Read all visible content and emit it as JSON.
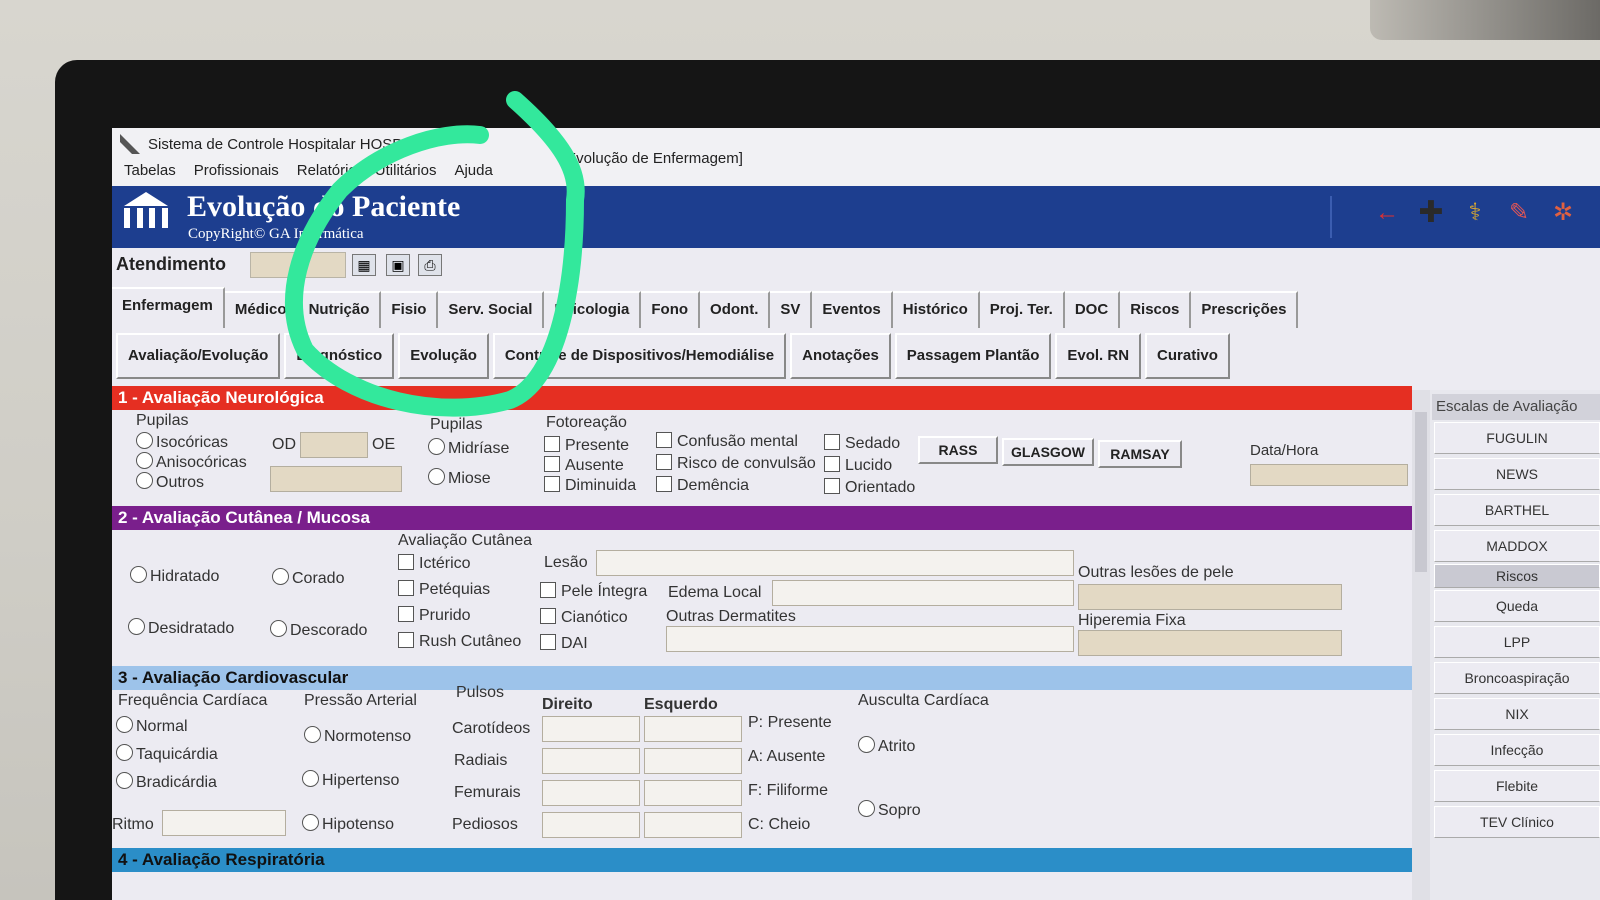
{
  "window": {
    "title": "Sistema de Controle Hospitalar HOSP",
    "subtitle": "[Evolução de Enfermagem]"
  },
  "menu": [
    "Tabelas",
    "Profissionais",
    "Relatório",
    "Utilitários",
    "Ajuda"
  ],
  "banner": {
    "title": "Evolução do Paciente",
    "copyright": "CopyRight© GA Informática"
  },
  "atendimento": {
    "label": "Atendimento",
    "value": ""
  },
  "main_tabs": [
    "Enfermagem",
    "Médico",
    "Nutrição",
    "Fisio",
    "Serv. Social",
    "Psicologia",
    "Fono",
    "Odont.",
    "SV",
    "Eventos",
    "Histórico",
    "Proj. Ter.",
    "DOC",
    "Riscos",
    "Prescrições"
  ],
  "sub_tabs": [
    "Avaliação/Evolução",
    "Diagnóstico",
    "Evolução",
    "Controle de Dispositivos/Hemodiálise",
    "Anotações",
    "Passagem Plantão",
    "Evol. RN",
    "Curativo"
  ],
  "sec1": {
    "title": "1 - Avaliação Neurológica",
    "pupilas_label": "Pupilas",
    "pupilas_opts": [
      "Isocóricas",
      "Anisocóricas",
      "Outros"
    ],
    "od": "OD",
    "oe": "OE",
    "pupilas2_label": "Pupilas",
    "pupilas2_opts": [
      "Midríase",
      "Miose"
    ],
    "foto_label": "Fotoreação",
    "foto_opts": [
      "Presente",
      "Ausente",
      "Diminuida"
    ],
    "mental_opts": [
      "Confusão mental",
      "Risco de convulsão",
      "Demência"
    ],
    "estado_opts": [
      "Sedado",
      "Lucido",
      "Orientado"
    ],
    "buttons": [
      "RASS",
      "GLASGOW",
      "RAMSAY"
    ],
    "datahora": "Data/Hora"
  },
  "sec2": {
    "title": "2 - Avaliação Cutânea / Mucosa",
    "hid_opts": [
      "Hidratado",
      "Desidratado"
    ],
    "cor_opts": [
      "Corado",
      "Descorado"
    ],
    "cutanea_label": "Avaliação Cutânea",
    "cut_opts1": [
      "Ictérico",
      "Petéquias",
      "Prurido",
      "Rush Cutâneo"
    ],
    "lesao": "Lesão",
    "cut_opts2": [
      "Pele Íntegra",
      "Cianótico",
      "DAI"
    ],
    "edema": "Edema Local",
    "outras_derm": "Outras Dermatites",
    "outras_lesoes": "Outras lesões de pele",
    "hiperemia": "Hiperemia Fixa"
  },
  "sec3": {
    "title": "3 - Avaliação Cardiovascular",
    "fc_label": "Frequência Cardíaca",
    "fc_opts": [
      "Normal",
      "Taquicárdia",
      "Bradicárdia"
    ],
    "pa_label": "Pressão Arterial",
    "pa_opts": [
      "Normotenso",
      "Hipertenso",
      "Hipotenso"
    ],
    "pulsos_label": "Pulsos",
    "direito": "Direito",
    "esquerdo": "Esquerdo",
    "pulsos": [
      "Carotídeos",
      "Radiais",
      "Femurais",
      "Pediosos"
    ],
    "legend": [
      "P: Presente",
      "A: Ausente",
      "F: Filiforme",
      "C: Cheio"
    ],
    "ausculta_label": "Ausculta Cardíaca",
    "ausculta_opts": [
      "Atrito",
      "Sopro"
    ],
    "ritmo": "Ritmo"
  },
  "sec4": {
    "title": "4 - Avaliação Respiratória"
  },
  "right_panel": {
    "header": "Escalas de Avaliação",
    "items": [
      "FUGULIN",
      "NEWS",
      "BARTHEL",
      "MADDOX",
      "Riscos",
      "Queda",
      "LPP",
      "Broncoaspiração",
      "NIX",
      "Infecção",
      "Flebite",
      "TEV Clínico"
    ]
  },
  "colors": {
    "banner": "#1d3e8f",
    "sec1": "#e52f22",
    "sec2": "#7a1f8c",
    "sec3": "#9dc3ea",
    "sec4": "#2b8ec8",
    "annotation": "#33e89c"
  }
}
